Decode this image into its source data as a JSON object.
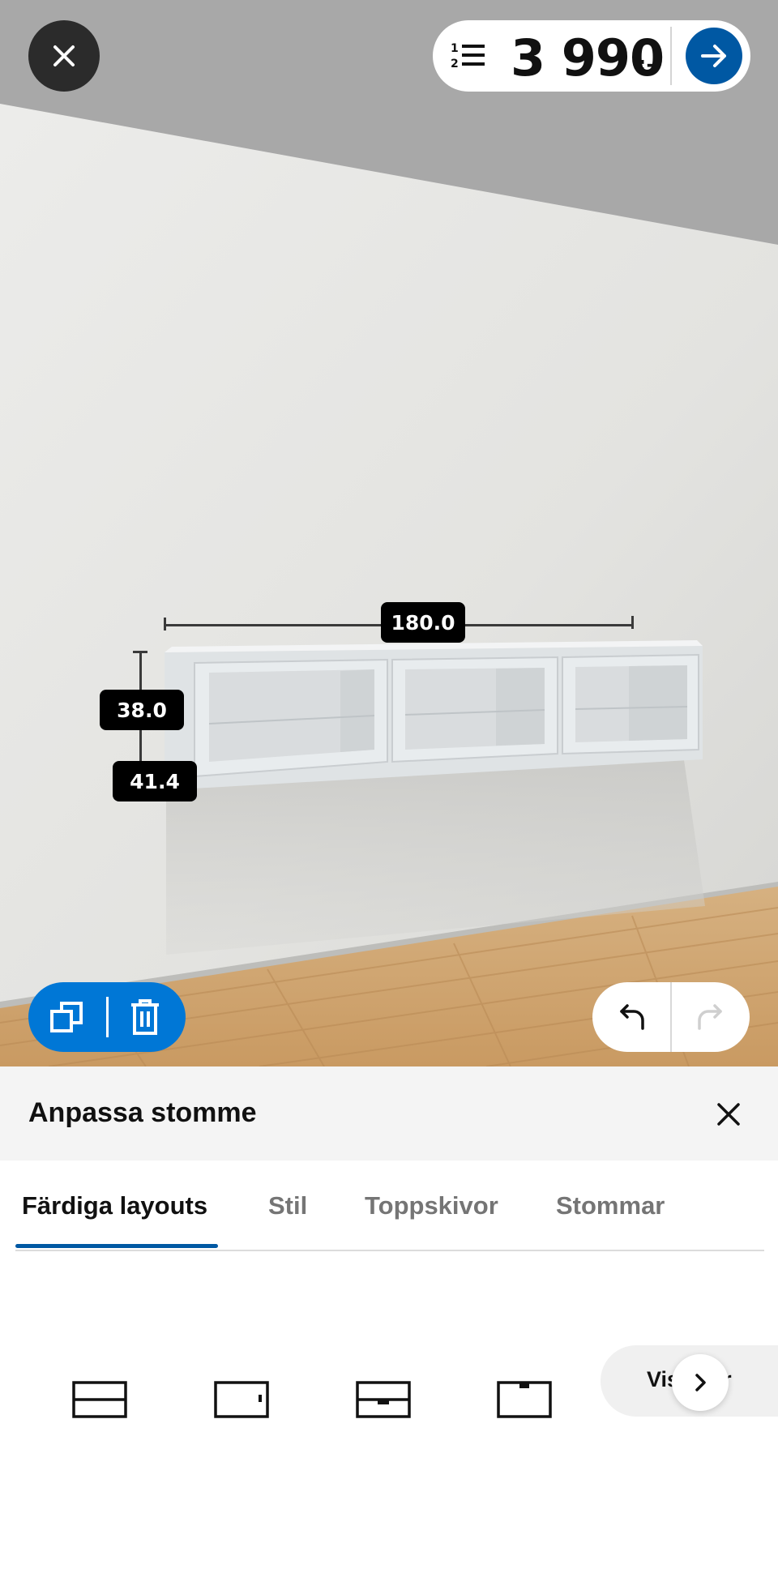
{
  "header": {
    "close_icon": "close-icon",
    "list_icon": "numbered-list-icon",
    "price": "3 990",
    "price_suffix": ":-",
    "go_icon": "arrow-right-icon"
  },
  "scene": {
    "dimensions": {
      "width": "180.0",
      "height": "38.0",
      "depth": "41.4"
    },
    "actions": {
      "duplicate_icon": "duplicate-icon",
      "delete_icon": "trash-icon",
      "undo_icon": "undo-icon",
      "redo_icon": "redo-icon"
    }
  },
  "sheet": {
    "title": "Anpassa stomme",
    "close_icon": "close-icon",
    "tabs": [
      {
        "label": "Färdiga layouts",
        "active": true
      },
      {
        "label": "Stil",
        "active": false
      },
      {
        "label": "Toppskivor",
        "active": false
      },
      {
        "label": "Stommar",
        "active": false
      }
    ],
    "options": [
      {
        "icon": "two-drawers-layout-icon"
      },
      {
        "icon": "door-layout-icon"
      },
      {
        "icon": "drawer-handle-layout-icon"
      },
      {
        "icon": "top-handle-layout-icon"
      }
    ],
    "show_more_label": "Visa fler",
    "show_more_icon": "chevron-right-icon"
  },
  "colors": {
    "accent": "#0058a3",
    "action_blue": "#0077d6",
    "dark_button": "#2b2b2b"
  }
}
